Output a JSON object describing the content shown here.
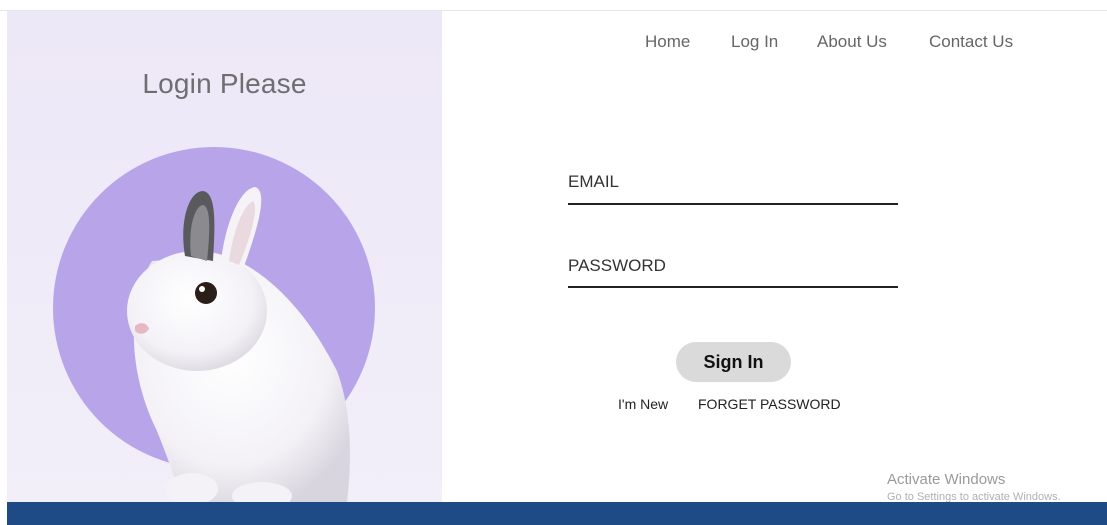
{
  "left": {
    "title": "Login Please"
  },
  "nav": {
    "items": [
      "Home",
      "Log In",
      "About Us",
      "Contact Us"
    ]
  },
  "form": {
    "email_label": "EMAIL",
    "password_label": "PASSWORD",
    "signin_label": "Sign In",
    "new_link": "I'm New",
    "forgot_link": "FORGET PASSWORD"
  },
  "watermark": {
    "line1": "Activate Windows",
    "line2": "Go to Settings to activate Windows."
  },
  "colors": {
    "accent_circle": "#b9a6ea",
    "footer": "#1e4a86",
    "button": "#dadada"
  }
}
